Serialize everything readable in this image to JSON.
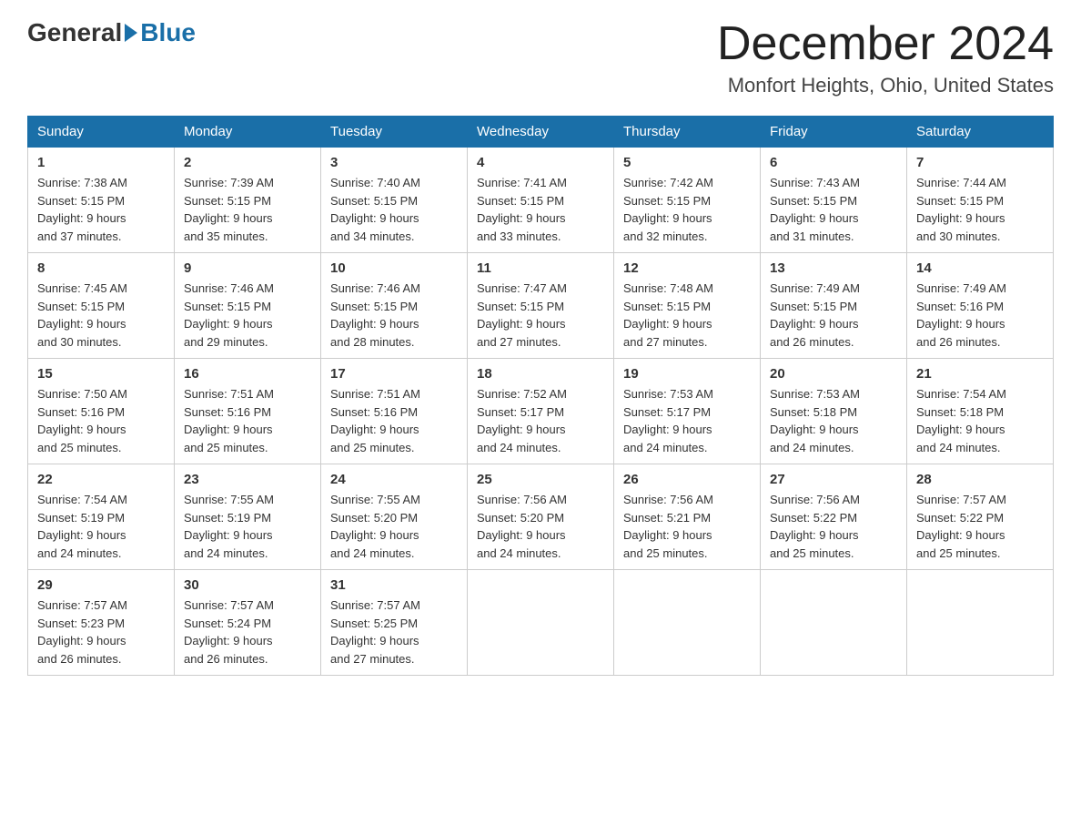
{
  "header": {
    "logo_text_general": "General",
    "logo_text_blue": "Blue",
    "month_title": "December 2024",
    "location": "Monfort Heights, Ohio, United States"
  },
  "days_of_week": [
    "Sunday",
    "Monday",
    "Tuesday",
    "Wednesday",
    "Thursday",
    "Friday",
    "Saturday"
  ],
  "weeks": [
    [
      {
        "day": "1",
        "sunrise": "7:38 AM",
        "sunset": "5:15 PM",
        "daylight": "9 hours and 37 minutes."
      },
      {
        "day": "2",
        "sunrise": "7:39 AM",
        "sunset": "5:15 PM",
        "daylight": "9 hours and 35 minutes."
      },
      {
        "day": "3",
        "sunrise": "7:40 AM",
        "sunset": "5:15 PM",
        "daylight": "9 hours and 34 minutes."
      },
      {
        "day": "4",
        "sunrise": "7:41 AM",
        "sunset": "5:15 PM",
        "daylight": "9 hours and 33 minutes."
      },
      {
        "day": "5",
        "sunrise": "7:42 AM",
        "sunset": "5:15 PM",
        "daylight": "9 hours and 32 minutes."
      },
      {
        "day": "6",
        "sunrise": "7:43 AM",
        "sunset": "5:15 PM",
        "daylight": "9 hours and 31 minutes."
      },
      {
        "day": "7",
        "sunrise": "7:44 AM",
        "sunset": "5:15 PM",
        "daylight": "9 hours and 30 minutes."
      }
    ],
    [
      {
        "day": "8",
        "sunrise": "7:45 AM",
        "sunset": "5:15 PM",
        "daylight": "9 hours and 30 minutes."
      },
      {
        "day": "9",
        "sunrise": "7:46 AM",
        "sunset": "5:15 PM",
        "daylight": "9 hours and 29 minutes."
      },
      {
        "day": "10",
        "sunrise": "7:46 AM",
        "sunset": "5:15 PM",
        "daylight": "9 hours and 28 minutes."
      },
      {
        "day": "11",
        "sunrise": "7:47 AM",
        "sunset": "5:15 PM",
        "daylight": "9 hours and 27 minutes."
      },
      {
        "day": "12",
        "sunrise": "7:48 AM",
        "sunset": "5:15 PM",
        "daylight": "9 hours and 27 minutes."
      },
      {
        "day": "13",
        "sunrise": "7:49 AM",
        "sunset": "5:15 PM",
        "daylight": "9 hours and 26 minutes."
      },
      {
        "day": "14",
        "sunrise": "7:49 AM",
        "sunset": "5:16 PM",
        "daylight": "9 hours and 26 minutes."
      }
    ],
    [
      {
        "day": "15",
        "sunrise": "7:50 AM",
        "sunset": "5:16 PM",
        "daylight": "9 hours and 25 minutes."
      },
      {
        "day": "16",
        "sunrise": "7:51 AM",
        "sunset": "5:16 PM",
        "daylight": "9 hours and 25 minutes."
      },
      {
        "day": "17",
        "sunrise": "7:51 AM",
        "sunset": "5:16 PM",
        "daylight": "9 hours and 25 minutes."
      },
      {
        "day": "18",
        "sunrise": "7:52 AM",
        "sunset": "5:17 PM",
        "daylight": "9 hours and 24 minutes."
      },
      {
        "day": "19",
        "sunrise": "7:53 AM",
        "sunset": "5:17 PM",
        "daylight": "9 hours and 24 minutes."
      },
      {
        "day": "20",
        "sunrise": "7:53 AM",
        "sunset": "5:18 PM",
        "daylight": "9 hours and 24 minutes."
      },
      {
        "day": "21",
        "sunrise": "7:54 AM",
        "sunset": "5:18 PM",
        "daylight": "9 hours and 24 minutes."
      }
    ],
    [
      {
        "day": "22",
        "sunrise": "7:54 AM",
        "sunset": "5:19 PM",
        "daylight": "9 hours and 24 minutes."
      },
      {
        "day": "23",
        "sunrise": "7:55 AM",
        "sunset": "5:19 PM",
        "daylight": "9 hours and 24 minutes."
      },
      {
        "day": "24",
        "sunrise": "7:55 AM",
        "sunset": "5:20 PM",
        "daylight": "9 hours and 24 minutes."
      },
      {
        "day": "25",
        "sunrise": "7:56 AM",
        "sunset": "5:20 PM",
        "daylight": "9 hours and 24 minutes."
      },
      {
        "day": "26",
        "sunrise": "7:56 AM",
        "sunset": "5:21 PM",
        "daylight": "9 hours and 25 minutes."
      },
      {
        "day": "27",
        "sunrise": "7:56 AM",
        "sunset": "5:22 PM",
        "daylight": "9 hours and 25 minutes."
      },
      {
        "day": "28",
        "sunrise": "7:57 AM",
        "sunset": "5:22 PM",
        "daylight": "9 hours and 25 minutes."
      }
    ],
    [
      {
        "day": "29",
        "sunrise": "7:57 AM",
        "sunset": "5:23 PM",
        "daylight": "9 hours and 26 minutes."
      },
      {
        "day": "30",
        "sunrise": "7:57 AM",
        "sunset": "5:24 PM",
        "daylight": "9 hours and 26 minutes."
      },
      {
        "day": "31",
        "sunrise": "7:57 AM",
        "sunset": "5:25 PM",
        "daylight": "9 hours and 27 minutes."
      },
      null,
      null,
      null,
      null
    ]
  ],
  "labels": {
    "sunrise_prefix": "Sunrise: ",
    "sunset_prefix": "Sunset: ",
    "daylight_prefix": "Daylight: "
  }
}
